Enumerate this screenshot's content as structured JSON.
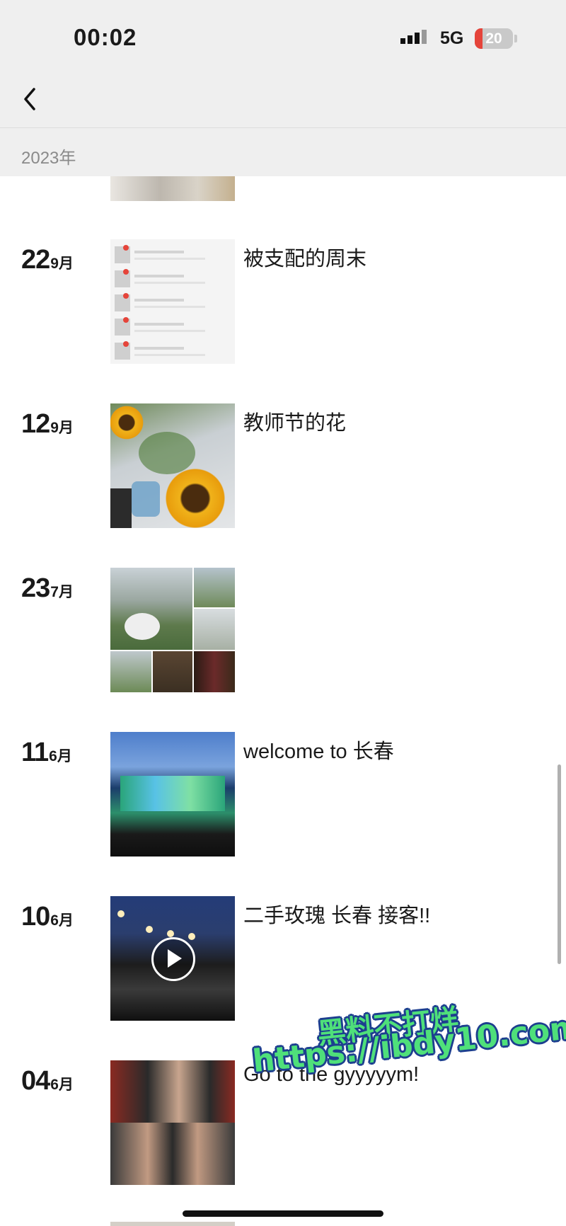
{
  "status_bar": {
    "time": "00:02",
    "network": "5G",
    "battery": "20",
    "battery_level": 0.2
  },
  "nav": {
    "back_icon": "chevron-left-icon"
  },
  "section": {
    "year": "2023年"
  },
  "entries": [
    {
      "day": "22",
      "month": "9月",
      "caption": "被支配的周末",
      "thumbnail": "list"
    },
    {
      "day": "12",
      "month": "9月",
      "caption": "教师节的花",
      "thumbnail": "flowers"
    },
    {
      "day": "23",
      "month": "7月",
      "caption": "",
      "thumbnail": "grid"
    },
    {
      "day": "11",
      "month": "6月",
      "caption": "welcome to 长春",
      "thumbnail": "stage"
    },
    {
      "day": "10",
      "month": "6月",
      "caption": "二手玫瑰 长春 接客!!",
      "thumbnail": "video",
      "is_video": true
    },
    {
      "day": "04",
      "month": "6月",
      "caption": "Go to the gyyyyym!",
      "thumbnail": "gym"
    }
  ],
  "watermark": {
    "line1": "黑料不打烊",
    "line2": "https://ibdy10.com"
  },
  "colors": {
    "bar_bg": "#efefef",
    "battery_red": "#e5443a",
    "watermark_green": "#4fe07a"
  }
}
